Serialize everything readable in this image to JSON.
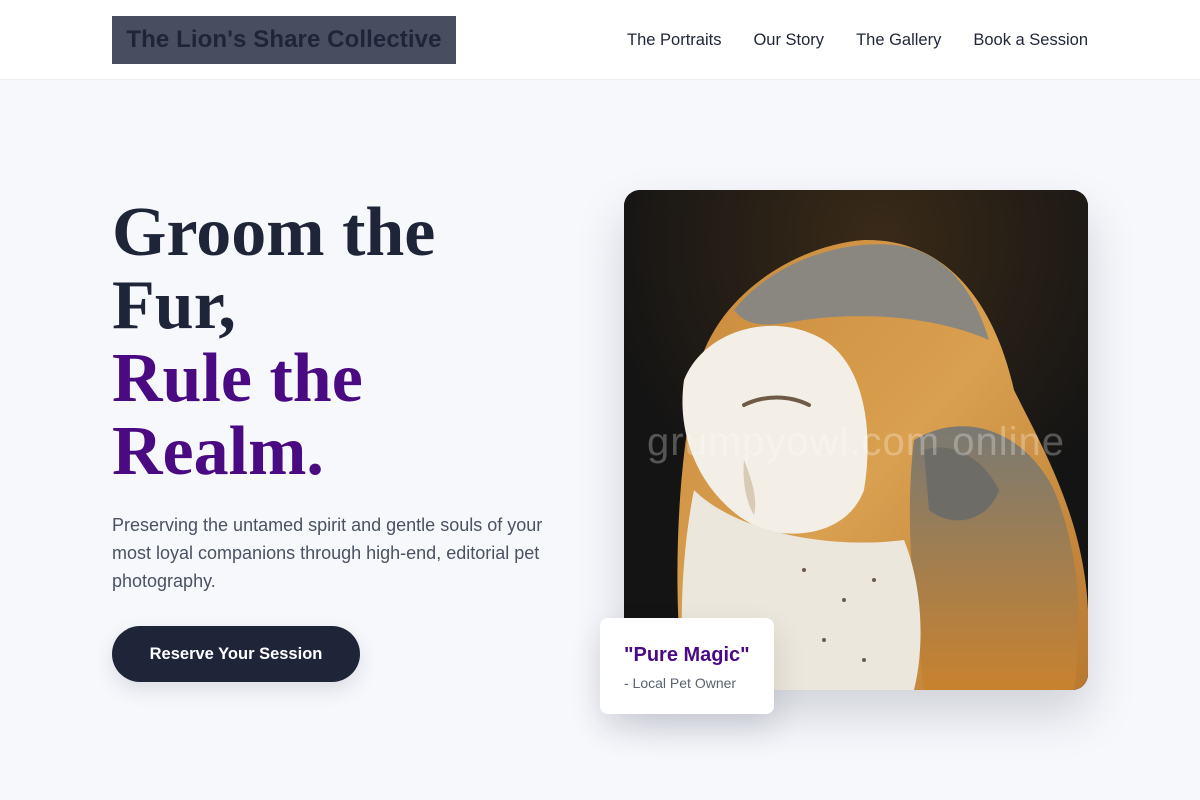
{
  "brand": {
    "logo_text": "The Lion's Share Collective"
  },
  "nav": {
    "items": [
      {
        "label": "The Portraits"
      },
      {
        "label": "Our Story"
      },
      {
        "label": "The Gallery"
      },
      {
        "label": "Book a Session"
      }
    ]
  },
  "hero": {
    "title_lines": [
      "Groom the",
      "Fur,"
    ],
    "accent_lines": [
      "Rule the",
      "Realm."
    ],
    "subtitle": "Preserving the untamed spirit and gentle souls of your most loyal companions through high-end, editorial pet photography.",
    "cta_label": "Reserve Your Session"
  },
  "image": {
    "subject": "barn-owl-photo",
    "watermark": "grumpyowl.com online"
  },
  "testimonial": {
    "quote": "\"Pure Magic\"",
    "attribution": "- Local Pet Owner"
  },
  "colors": {
    "primary": "#1e2538",
    "accent": "#4a0a82",
    "background": "#f7f8fc",
    "logo_bg": "#464e5f"
  }
}
